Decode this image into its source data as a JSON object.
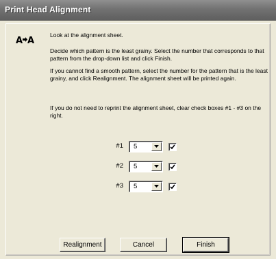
{
  "window": {
    "title": "Print Head Alignment"
  },
  "icon": {
    "name": "alignment-icon",
    "glyph": "A→A"
  },
  "instructions": {
    "p1": "Look at the alignment sheet.",
    "p2": "Decide which pattern is the least grainy. Select the number that corresponds to that pattern from the drop-down list and click Finish.",
    "p3": "If you cannot find a smooth pattern, select the number for the pattern that is the least grainy, and click Realignment. The alignment sheet will be printed again.",
    "p4": "If you do not need to reprint the alignment sheet, clear check boxes #1 - #3 on the right."
  },
  "rows": [
    {
      "label": "#1",
      "value": "5",
      "checked": true
    },
    {
      "label": "#2",
      "value": "5",
      "checked": true
    },
    {
      "label": "#3",
      "value": "5",
      "checked": true
    }
  ],
  "buttons": {
    "realignment": "Realignment",
    "cancel": "Cancel",
    "finish": "Finish"
  }
}
